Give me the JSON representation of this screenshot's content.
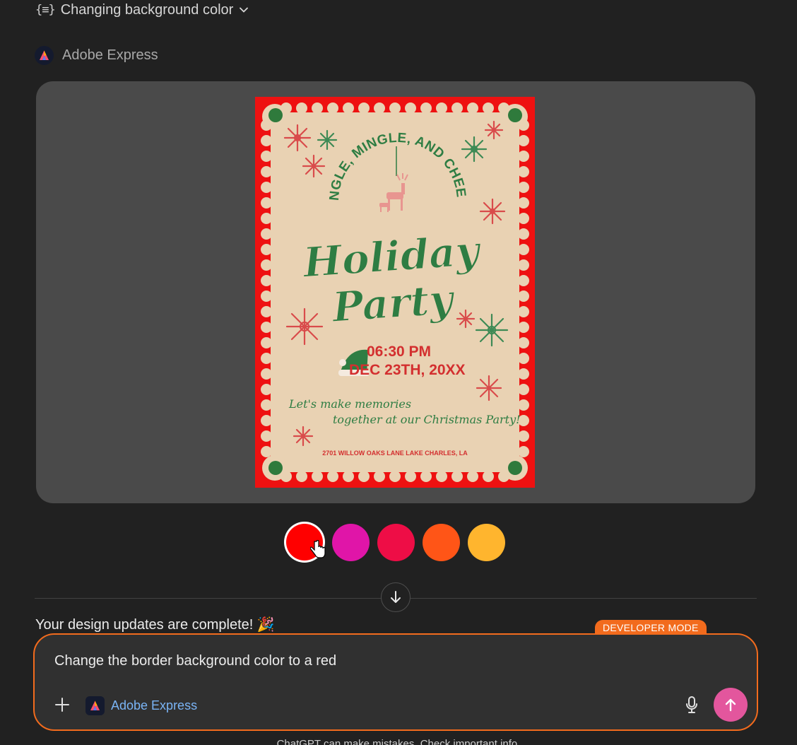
{
  "tool_header": {
    "label": "Changing background color"
  },
  "app": {
    "name": "Adobe Express"
  },
  "flyer": {
    "arc_title": "JINGLE, MINGLE, AND CHEER!",
    "title_line1": "Holiday",
    "title_line2": "Party",
    "time": "06:30 PM",
    "date": "DEC 23TH, 20XX",
    "tagline1": "Let's make memories",
    "tagline2": "together at our Christmas Party!",
    "address": "2701 WILLOW OAKS LANE LAKE CHARLES, LA",
    "colors": {
      "border": "#ee1111",
      "paper": "#e9d2b3",
      "green": "#2e7d43",
      "red": "#d32f2f",
      "dot": "#2f7a3c"
    }
  },
  "swatches": [
    {
      "color": "#ff0000",
      "selected": true
    },
    {
      "color": "#e015a8",
      "selected": false
    },
    {
      "color": "#ee0d46",
      "selected": false
    },
    {
      "color": "#ff5517",
      "selected": false
    },
    {
      "color": "#ffb52e",
      "selected": false
    }
  ],
  "message": {
    "text": "Your design updates are complete! 🎉"
  },
  "composer": {
    "badge": "DEVELOPER MODE",
    "text": "Change the border background color to a red",
    "app_name": "Adobe Express",
    "accent": "#f26b1d",
    "send_color": "#e3569d"
  },
  "footer": {
    "text": "ChatGPT can make mistakes. Check important info."
  }
}
